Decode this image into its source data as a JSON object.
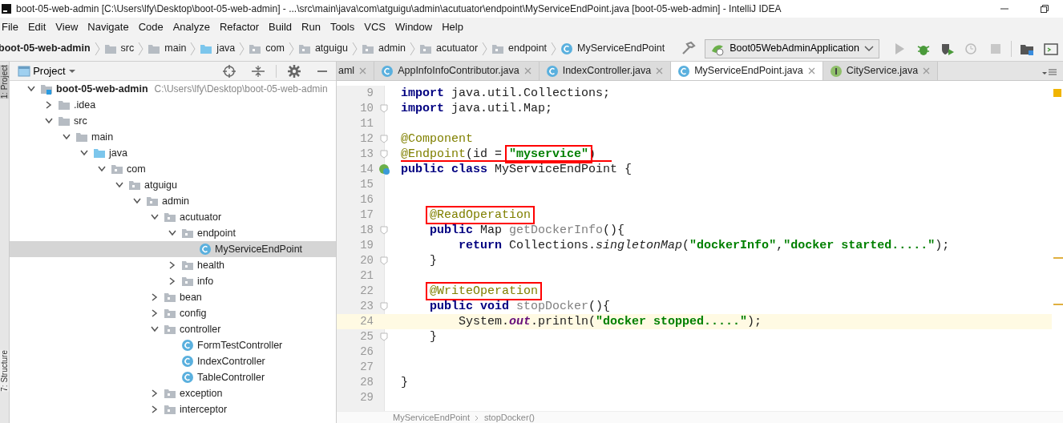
{
  "window": {
    "title": "boot-05-web-admin [C:\\Users\\lfy\\Desktop\\boot-05-web-admin] - ...\\src\\main\\java\\com\\atguigu\\admin\\acutuator\\endpoint\\MyServiceEndPoint.java [boot-05-web-admin] - IntelliJ IDEA"
  },
  "menu": [
    "File",
    "Edit",
    "View",
    "Navigate",
    "Code",
    "Analyze",
    "Refactor",
    "Build",
    "Run",
    "Tools",
    "VCS",
    "Window",
    "Help"
  ],
  "breadcrumb": [
    {
      "label": "boot-05-web-admin",
      "kind": "project"
    },
    {
      "label": "src",
      "kind": "folder"
    },
    {
      "label": "main",
      "kind": "folder"
    },
    {
      "label": "java",
      "kind": "source"
    },
    {
      "label": "com",
      "kind": "package"
    },
    {
      "label": "atguigu",
      "kind": "package"
    },
    {
      "label": "admin",
      "kind": "package"
    },
    {
      "label": "acutuator",
      "kind": "package"
    },
    {
      "label": "endpoint",
      "kind": "package"
    },
    {
      "label": "MyServiceEndPoint",
      "kind": "class"
    }
  ],
  "run_config": "Boot05WebAdminApplication",
  "side_strip": [
    "1: Project",
    "7: Structure"
  ],
  "project_panel": {
    "title": "Project",
    "tree": [
      {
        "label": "boot-05-web-admin",
        "path": "C:\\Users\\lfy\\Desktop\\boot-05-web-admin",
        "kind": "module",
        "expanded": true,
        "selected": false,
        "children": [
          {
            "label": ".idea",
            "kind": "folder",
            "expanded": false,
            "selected": false
          },
          {
            "label": "src",
            "kind": "folder",
            "expanded": true,
            "selected": false,
            "children": [
              {
                "label": "main",
                "kind": "folder",
                "expanded": true,
                "selected": false,
                "children": [
                  {
                    "label": "java",
                    "kind": "source",
                    "expanded": true,
                    "selected": false,
                    "children": [
                      {
                        "label": "com",
                        "kind": "package",
                        "expanded": true,
                        "selected": false,
                        "children": [
                          {
                            "label": "atguigu",
                            "kind": "package",
                            "expanded": true,
                            "selected": false,
                            "children": [
                              {
                                "label": "admin",
                                "kind": "package",
                                "expanded": true,
                                "selected": false,
                                "children": [
                                  {
                                    "label": "acutuator",
                                    "kind": "package",
                                    "expanded": true,
                                    "selected": false,
                                    "children": [
                                      {
                                        "label": "endpoint",
                                        "kind": "package",
                                        "expanded": true,
                                        "selected": false,
                                        "children": [
                                          {
                                            "label": "MyServiceEndPoint",
                                            "kind": "class",
                                            "selected": true
                                          }
                                        ]
                                      },
                                      {
                                        "label": "health",
                                        "kind": "package",
                                        "expanded": false,
                                        "selected": false
                                      },
                                      {
                                        "label": "info",
                                        "kind": "package",
                                        "expanded": false,
                                        "selected": false
                                      }
                                    ]
                                  },
                                  {
                                    "label": "bean",
                                    "kind": "package",
                                    "expanded": false,
                                    "selected": false
                                  },
                                  {
                                    "label": "config",
                                    "kind": "package",
                                    "expanded": false,
                                    "selected": false
                                  },
                                  {
                                    "label": "controller",
                                    "kind": "package",
                                    "expanded": true,
                                    "selected": false,
                                    "children": [
                                      {
                                        "label": "FormTestController",
                                        "kind": "class",
                                        "selected": false
                                      },
                                      {
                                        "label": "IndexController",
                                        "kind": "class",
                                        "selected": false
                                      },
                                      {
                                        "label": "TableController",
                                        "kind": "class",
                                        "selected": false
                                      }
                                    ]
                                  },
                                  {
                                    "label": "exception",
                                    "kind": "package",
                                    "expanded": false,
                                    "selected": false
                                  },
                                  {
                                    "label": "interceptor",
                                    "kind": "package",
                                    "expanded": false,
                                    "selected": false
                                  }
                                ]
                              }
                            ]
                          }
                        ]
                      }
                    ]
                  }
                ]
              }
            ]
          }
        ]
      }
    ]
  },
  "tabs": [
    {
      "label": "aml",
      "kind": "file",
      "selected": false
    },
    {
      "label": "AppInfoInfoContributor.java",
      "kind": "class",
      "selected": false
    },
    {
      "label": "IndexController.java",
      "kind": "class",
      "selected": false
    },
    {
      "label": "MyServiceEndPoint.java",
      "kind": "class",
      "selected": true
    },
    {
      "label": "CityService.java",
      "kind": "interface",
      "selected": false
    }
  ],
  "code": [
    {
      "n": "9",
      "tokens": [
        {
          "t": "import ",
          "kind": "keyword"
        },
        {
          "t": "java.util.Collections;",
          "kind": "plain"
        }
      ]
    },
    {
      "n": "10",
      "fold": true,
      "tokens": [
        {
          "t": "import ",
          "kind": "keyword"
        },
        {
          "t": "java.util.Map;",
          "kind": "plain"
        }
      ]
    },
    {
      "n": "11"
    },
    {
      "n": "12",
      "fold": true,
      "tokens": [
        {
          "t": "@Component",
          "kind": "annotation"
        }
      ]
    },
    {
      "n": "13",
      "fold": true,
      "underlined": true,
      "tokens": [
        {
          "t": "@Endpoint",
          "kind": "annotation"
        },
        {
          "t": "(id = ",
          "kind": "plain"
        },
        {
          "t": "\"myservice\"",
          "kind": "string",
          "boxed": true
        },
        {
          "t": ")",
          "kind": "plain"
        }
      ]
    },
    {
      "n": "14",
      "gutter_icon": true,
      "tokens": [
        {
          "t": "public class ",
          "kind": "keyword"
        },
        {
          "t": "MyServiceEndPoint {",
          "kind": "plain"
        }
      ]
    },
    {
      "n": "15"
    },
    {
      "n": "16"
    },
    {
      "n": "17",
      "tokens": [
        {
          "t": "    @ReadOperation",
          "kind": "annotation",
          "boxed": true
        }
      ]
    },
    {
      "n": "18",
      "fold": true,
      "tokens": [
        {
          "t": "    public ",
          "kind": "keyword"
        },
        {
          "t": "Map ",
          "kind": "plain"
        },
        {
          "t": "getDockerInfo",
          "kind": "unused"
        },
        {
          "t": "(){",
          "kind": "plain"
        }
      ]
    },
    {
      "n": "19",
      "tokens": [
        {
          "t": "        return ",
          "kind": "keyword"
        },
        {
          "t": "Collections.",
          "kind": "plain"
        },
        {
          "t": "singletonMap",
          "kind": "static"
        },
        {
          "t": "(",
          "kind": "plain"
        },
        {
          "t": "\"dockerInfo\"",
          "kind": "string"
        },
        {
          "t": ",",
          "kind": "plain"
        },
        {
          "t": "\"docker started.....\"",
          "kind": "string"
        },
        {
          "t": ");",
          "kind": "plain"
        }
      ]
    },
    {
      "n": "20",
      "fold": true,
      "tokens": [
        {
          "t": "    }",
          "kind": "plain"
        }
      ]
    },
    {
      "n": "21"
    },
    {
      "n": "22",
      "tokens": [
        {
          "t": "    @WriteOperation",
          "kind": "annotation",
          "boxed": true
        }
      ]
    },
    {
      "n": "23",
      "fold": true,
      "tokens": [
        {
          "t": "    public void ",
          "kind": "keyword"
        },
        {
          "t": "stopDocker",
          "kind": "unused"
        },
        {
          "t": "(){",
          "kind": "plain"
        }
      ]
    },
    {
      "n": "24",
      "current": true,
      "tokens": [
        {
          "t": "        System.",
          "kind": "plain"
        },
        {
          "t": "out",
          "kind": "field"
        },
        {
          "t": ".println(",
          "kind": "plain"
        },
        {
          "t": "\"docker stopped.....\"",
          "kind": "string"
        },
        {
          "t": ");",
          "kind": "plain"
        }
      ]
    },
    {
      "n": "25",
      "fold": true,
      "tokens": [
        {
          "t": "    }",
          "kind": "plain"
        }
      ]
    },
    {
      "n": "26"
    },
    {
      "n": "27"
    },
    {
      "n": "28",
      "tokens": [
        {
          "t": "}",
          "kind": "plain"
        }
      ]
    },
    {
      "n": "29"
    }
  ],
  "editor_breadcrumb": [
    "MyServiceEndPoint",
    "stopDocker()"
  ]
}
